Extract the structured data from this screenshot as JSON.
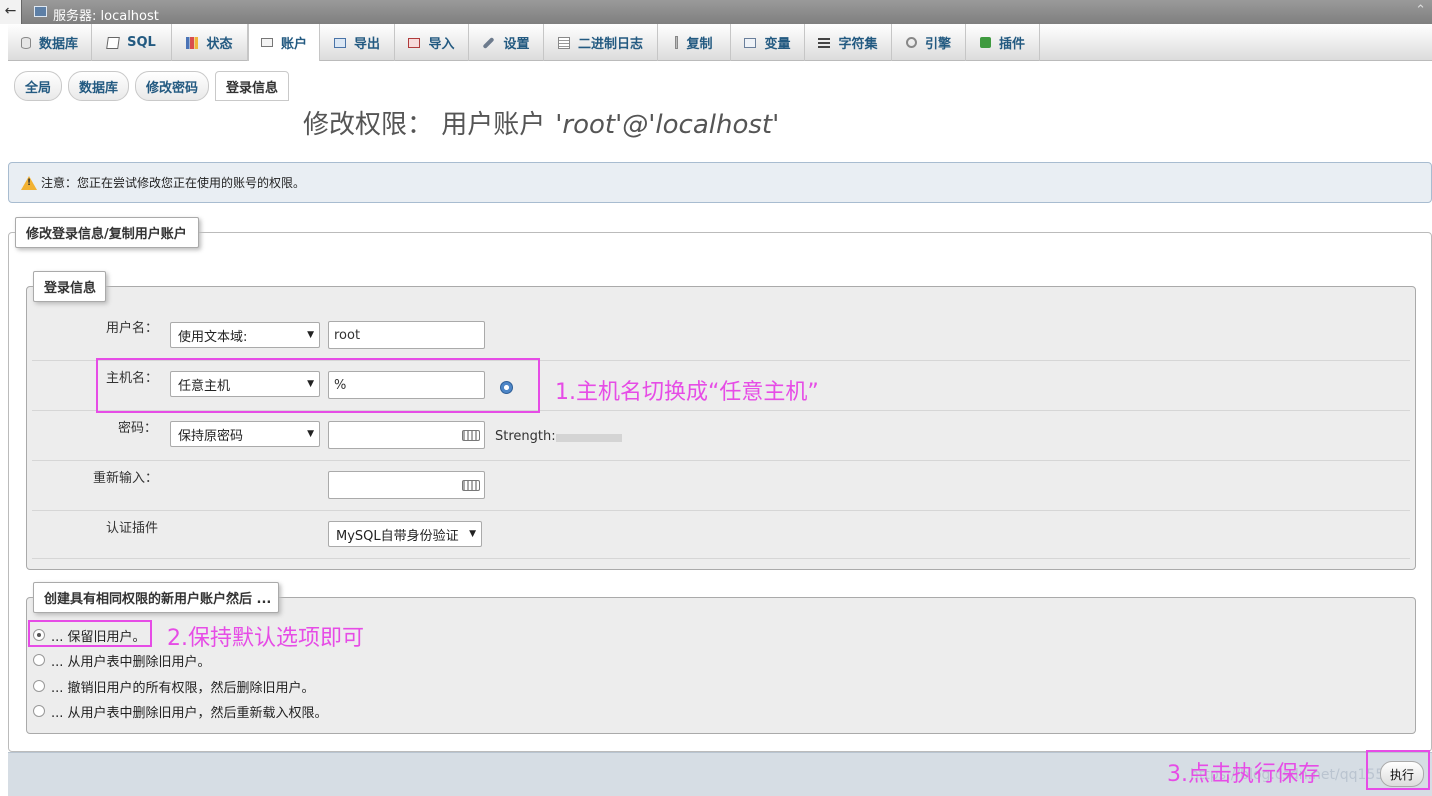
{
  "window": {
    "back_label": "←",
    "title": "服务器: localhost",
    "collapse_glyph": "⌃"
  },
  "topmenu": {
    "tabs": [
      {
        "label": "数据库",
        "icon": "database-icon"
      },
      {
        "label": "SQL",
        "icon": "sql-icon"
      },
      {
        "label": "状态",
        "icon": "status-chart-icon"
      },
      {
        "label": "账户",
        "icon": "user-accounts-icon",
        "active": true
      },
      {
        "label": "导出",
        "icon": "export-icon"
      },
      {
        "label": "导入",
        "icon": "import-icon"
      },
      {
        "label": "设置",
        "icon": "wrench-icon"
      },
      {
        "label": "二进制日志",
        "icon": "binlog-icon"
      },
      {
        "label": "复制",
        "icon": "replication-icon"
      },
      {
        "label": "变量",
        "icon": "variables-icon"
      },
      {
        "label": "字符集",
        "icon": "charset-icon"
      },
      {
        "label": "引擎",
        "icon": "engine-icon"
      },
      {
        "label": "插件",
        "icon": "plugin-icon"
      }
    ]
  },
  "subtabs": [
    {
      "label": "全局"
    },
    {
      "label": "数据库"
    },
    {
      "label": "修改密码"
    },
    {
      "label": "登录信息",
      "active": true
    }
  ],
  "page_title": {
    "prefix": "修改权限： 用户账户",
    "account": "'root'@'localhost'"
  },
  "notice": {
    "text": "注意：您正在尝试修改您正在使用的账号的权限。"
  },
  "outer_fieldset": {
    "legend": "修改登录信息/复制用户账户"
  },
  "login_info": {
    "legend": "登录信息",
    "username": {
      "label": "用户名：",
      "mode": "使用文本域:",
      "value": "root"
    },
    "hostname": {
      "label": "主机名：",
      "mode": "任意主机",
      "value": "%"
    },
    "password": {
      "label": "密码：",
      "mode": "保持原密码",
      "value": "",
      "strength_label": "Strength:"
    },
    "retype": {
      "label": "重新输入：",
      "value": ""
    },
    "auth_plugin": {
      "label": "认证插件",
      "value": "MySQL自带身份验证"
    }
  },
  "copy_user": {
    "legend": "创建具有相同权限的新用户账户然后 ...",
    "options": [
      {
        "label": "... 保留旧用户。",
        "checked": true
      },
      {
        "label": "... 从用户表中删除旧用户。",
        "checked": false
      },
      {
        "label": "... 撤销旧用户的所有权限，然后删除旧用户。",
        "checked": false
      },
      {
        "label": "... 从用户表中删除旧用户，然后重新载入权限。",
        "checked": false
      }
    ]
  },
  "footer": {
    "execute_label": "执行",
    "watermark": "https://blog.csdn.net/qq1557..."
  },
  "annotations": {
    "step1": "1.主机名切换成“任意主机”",
    "step2": "2.保持默认选项即可",
    "step3": "3.点击执行保存"
  },
  "colors": {
    "annotation": "#e64ce6",
    "link": "#235a81",
    "warning": "#f2b233"
  }
}
